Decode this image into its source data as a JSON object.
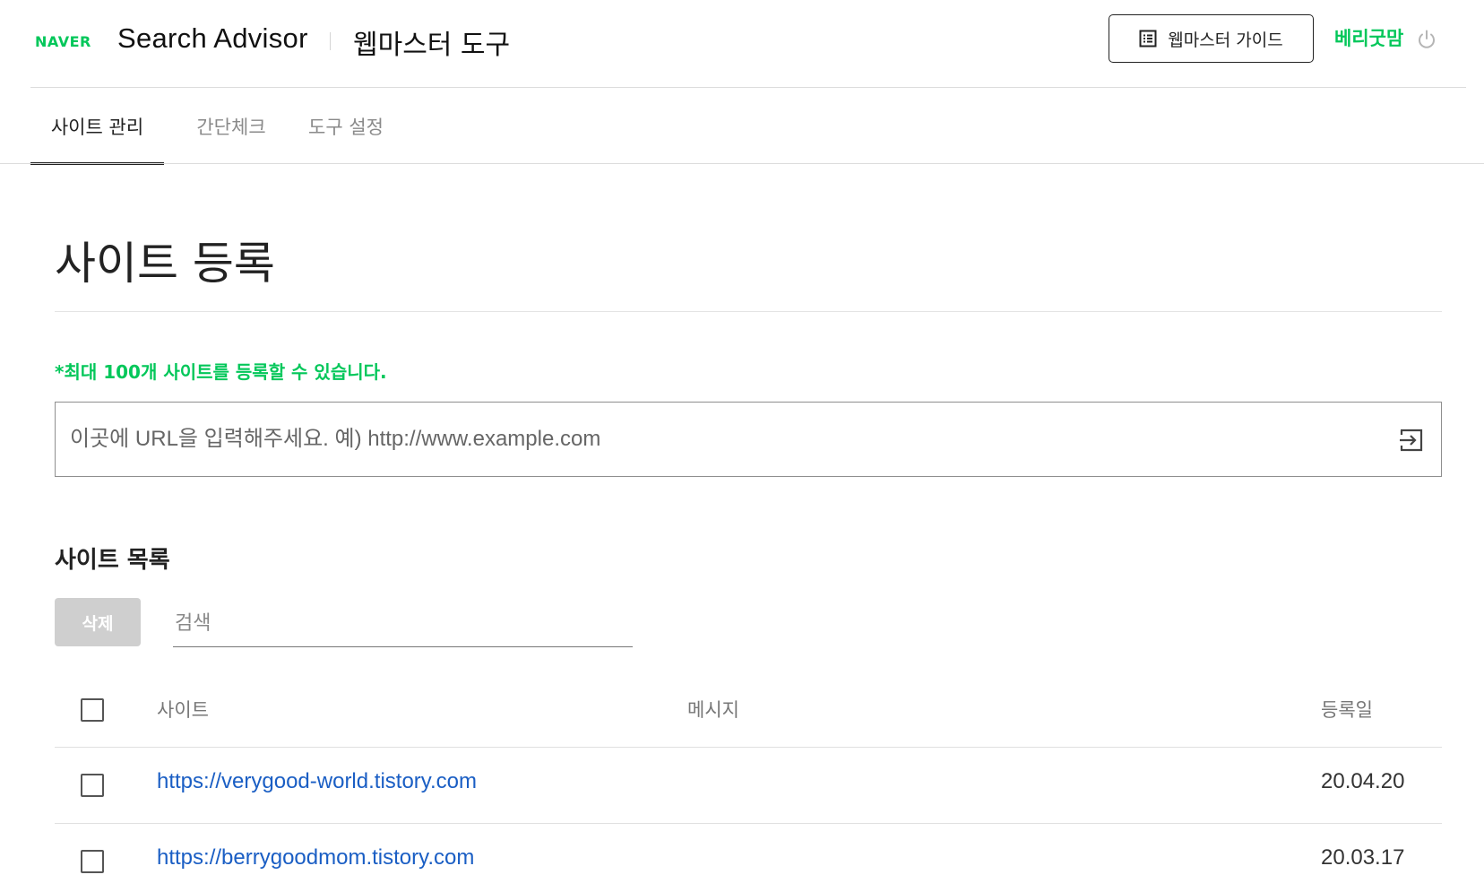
{
  "header": {
    "logo_text": "NAVER",
    "service_name": "Search Advisor",
    "tool_name": "웹마스터 도구",
    "guide_button_label": "웹마스터 가이드",
    "user_name": "베리굿맘",
    "icons": {
      "guide": "document-list-icon",
      "logout": "power-icon"
    },
    "brand_color": "#03c75a"
  },
  "tabs": [
    {
      "label": "사이트 관리",
      "active": true
    },
    {
      "label": "간단체크",
      "active": false
    },
    {
      "label": "도구 설정",
      "active": false
    }
  ],
  "main": {
    "page_title": "사이트 등록",
    "notice": "*최대 100개 사이트를 등록할 수 있습니다.",
    "url_input": {
      "placeholder": "이곳에 URL을 입력해주세요. 예) http://www.example.com",
      "value": ""
    },
    "list_title": "사이트 목록",
    "delete_button_label": "삭제",
    "search_placeholder": "검색",
    "table": {
      "columns": [
        "사이트",
        "메시지",
        "등록일"
      ],
      "rows": [
        {
          "site": "https://verygood-world.tistory.com",
          "message": "",
          "date": "20.04.20",
          "checked": false
        },
        {
          "site": "https://berrygoodmom.tistory.com",
          "message": "",
          "date": "20.03.17",
          "checked": false
        }
      ]
    },
    "link_color": "#1a5ec4"
  }
}
